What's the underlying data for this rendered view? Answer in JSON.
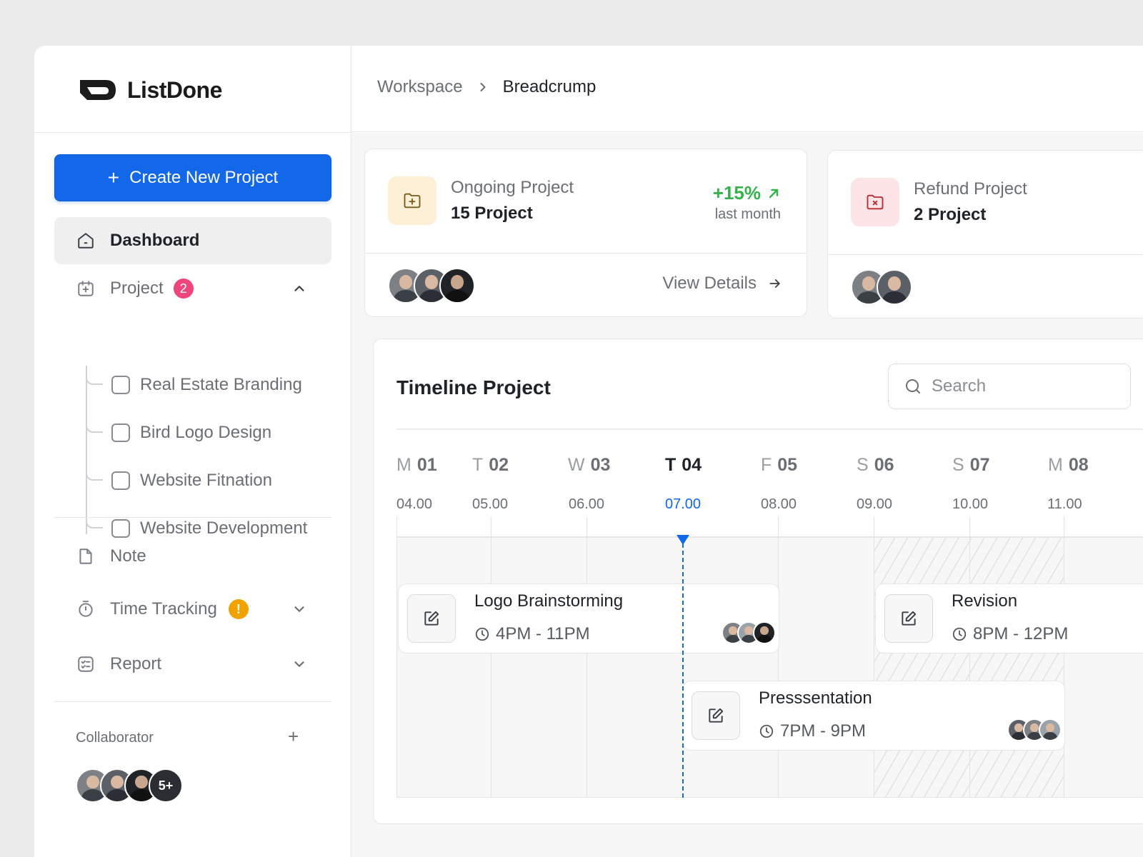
{
  "app": {
    "name": "ListDone"
  },
  "sidebar": {
    "create_button": "Create New Project",
    "nav": {
      "dashboard": "Dashboard",
      "project": "Project",
      "project_badge": "2",
      "note": "Note",
      "time_tracking": "Time Tracking",
      "time_tracking_badge": "!",
      "report": "Report"
    },
    "projects": [
      "Real Estate Branding",
      "Bird Logo Design",
      "Website Fitnation",
      "Website Development"
    ],
    "collaborator_label": "Collaborator",
    "collaborator_more": "5+"
  },
  "header": {
    "breadcrumb": [
      "Workspace",
      "Breadcrump"
    ]
  },
  "stats": [
    {
      "title": "Ongoing Project",
      "value": "15 Project",
      "growth": "+15%",
      "growth_sub": "last month",
      "link": "View Details"
    },
    {
      "title": "Refund Project",
      "value": "2 Project"
    }
  ],
  "timeline": {
    "title": "Timeline Project",
    "search_placeholder": "Search",
    "days": [
      {
        "letter": "M",
        "num": "01",
        "time": "04.00"
      },
      {
        "letter": "T",
        "num": "02",
        "time": "05.00"
      },
      {
        "letter": "W",
        "num": "03",
        "time": "06.00"
      },
      {
        "letter": "T",
        "num": "04",
        "time": "07.00"
      },
      {
        "letter": "F",
        "num": "05",
        "time": "08.00"
      },
      {
        "letter": "S",
        "num": "06",
        "time": "09.00"
      },
      {
        "letter": "S",
        "num": "07",
        "time": "10.00"
      },
      {
        "letter": "M",
        "num": "08",
        "time": "11.00"
      }
    ],
    "tasks": [
      {
        "name": "Logo Brainstorming",
        "time": "4PM - 11PM"
      },
      {
        "name": "Revision",
        "time": "8PM - 12PM"
      },
      {
        "name": "Presssentation",
        "time": "7PM - 9PM"
      }
    ]
  },
  "colors": {
    "primary": "#1268e8",
    "positive": "#35b24a",
    "badge": "#f0457a",
    "warning": "#f0a300"
  }
}
